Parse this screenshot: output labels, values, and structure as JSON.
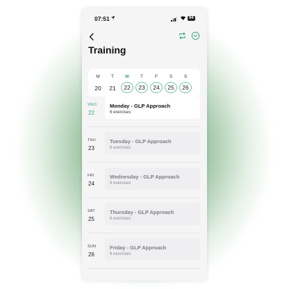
{
  "status_bar": {
    "time": "07:51",
    "battery": "94"
  },
  "header": {
    "title": "Training"
  },
  "week_strip": [
    {
      "letter": "M",
      "date": "20",
      "state": "past"
    },
    {
      "letter": "T",
      "date": "21",
      "state": "past"
    },
    {
      "letter": "W",
      "date": "22",
      "state": "selected"
    },
    {
      "letter": "T",
      "date": "23",
      "state": "scheduled"
    },
    {
      "letter": "F",
      "date": "24",
      "state": "scheduled"
    },
    {
      "letter": "S",
      "date": "25",
      "state": "scheduled"
    },
    {
      "letter": "S",
      "date": "26",
      "state": "scheduled"
    }
  ],
  "workouts": [
    {
      "day": "WED",
      "date": "22",
      "title": "Monday - GLP Approach",
      "subtitle": "6 exercises"
    },
    {
      "day": "THU",
      "date": "23",
      "title": "Tuesday - GLP Approach",
      "subtitle": "6 exercises"
    },
    {
      "day": "FRI",
      "date": "24",
      "title": "Wednesday - GLP Approach",
      "subtitle": "6 exercises"
    },
    {
      "day": "SAT",
      "date": "25",
      "title": "Thursday - GLP Approach",
      "subtitle": "6 exercises"
    },
    {
      "day": "SUN",
      "date": "26",
      "title": "Friday - GLP Approach",
      "subtitle": "6 exercises"
    }
  ],
  "colors": {
    "accent": "#3aa87a",
    "ring": "#6cc29b",
    "background_glow": "#3c8246"
  },
  "icons": [
    "location-arrow-icon",
    "signal-icon",
    "wifi-icon",
    "back-chevron-icon",
    "repeat-icon",
    "check-circle-icon"
  ]
}
